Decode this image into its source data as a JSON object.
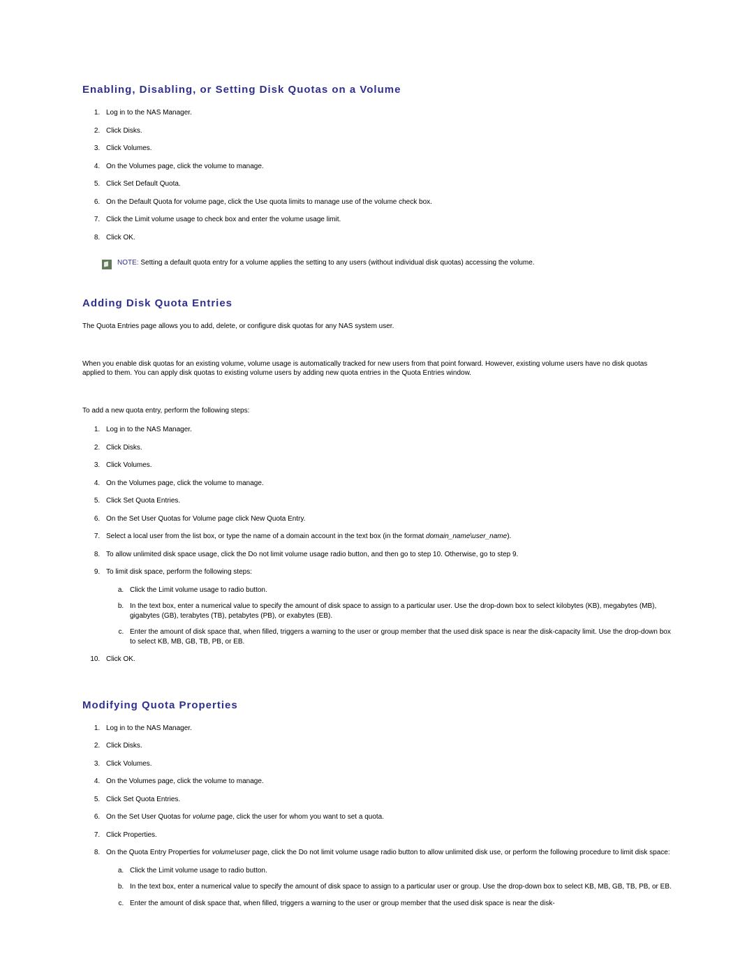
{
  "section1": {
    "heading": "Enabling, Disabling, or Setting Disk Quotas on a Volume",
    "steps": [
      "Log in to the NAS Manager.",
      "Click Disks.",
      "Click Volumes.",
      "On the Volumes page, click the volume to manage.",
      "Click Set Default Quota.",
      "On the Default Quota for volume page, click the Use quota limits to manage use of the volume check box.",
      "Click the Limit volume usage to check box and enter the volume usage limit.",
      "Click OK."
    ],
    "note_label": "NOTE:",
    "note_text": " Setting a default quota entry for a volume applies the setting to any users (without individual disk quotas) accessing the volume."
  },
  "section2": {
    "heading": "Adding Disk Quota Entries",
    "para1": "The Quota Entries page allows you to add, delete, or configure disk quotas for any NAS system user.",
    "para2": "When you enable disk quotas for an existing volume, volume usage is automatically tracked for new users from that point forward. However, existing volume users have no disk quotas applied to them. You can apply disk quotas to existing volume users by adding new quota entries in the Quota Entries window.",
    "para3": "To add a new quota entry, perform the following steps:",
    "steps": {
      "s1": "Log in to the NAS Manager.",
      "s2": "Click Disks.",
      "s3": "Click Volumes.",
      "s4": "On the Volumes page, click the volume to manage.",
      "s5": "Click Set Quota Entries.",
      "s6": "On the Set User Quotas for Volume page click New Quota Entry.",
      "s7_a": "Select a local user from the list box, or type the name of a domain account in the text box (in the format ",
      "s7_b": "domain_name\\user_name",
      "s7_c": ").",
      "s8": "To allow unlimited disk space usage, click the Do not limit volume usage radio button, and then go to step 10. Otherwise, go to step 9.",
      "s9": "To limit disk space, perform the following steps:",
      "s9a": "Click the Limit volume usage to radio button.",
      "s9b": "In the text box, enter a numerical value to specify the amount of disk space to assign to a particular user. Use the drop-down box to select kilobytes (KB), megabytes (MB), gigabytes (GB), terabytes (TB), petabytes (PB), or exabytes (EB).",
      "s9c": "Enter the amount of disk space that, when filled, triggers a warning to the user or group member that the used disk space is near the disk-capacity limit. Use the drop-down box to select KB, MB, GB, TB, PB, or EB.",
      "s10": "Click OK."
    }
  },
  "section3": {
    "heading": "Modifying Quota Properties",
    "steps": {
      "s1": "Log in to the NAS Manager.",
      "s2": "Click Disks.",
      "s3": "Click Volumes.",
      "s4": "On the Volumes page, click the volume to manage.",
      "s5": "Click Set Quota Entries.",
      "s6_a": "On the Set User Quotas for ",
      "s6_b": "volume",
      "s6_c": " page, click the user for whom you want to set a quota.",
      "s7": "Click Properties.",
      "s8_a": "On the Quota Entry Properties for ",
      "s8_b": "volume\\user",
      "s8_c": " page, click the Do not limit volume usage radio button to allow unlimited disk use, or perform the following procedure to limit disk space:",
      "s8a": "Click the Limit volume usage to radio button.",
      "s8b": "In the text box, enter a numerical value to specify the amount of disk space to assign to a particular user or group. Use the drop-down box to select KB, MB, GB, TB, PB, or EB.",
      "s8c": "Enter the amount of disk space that, when filled, triggers a warning to the user or group member that the used disk space is near the disk-"
    }
  }
}
